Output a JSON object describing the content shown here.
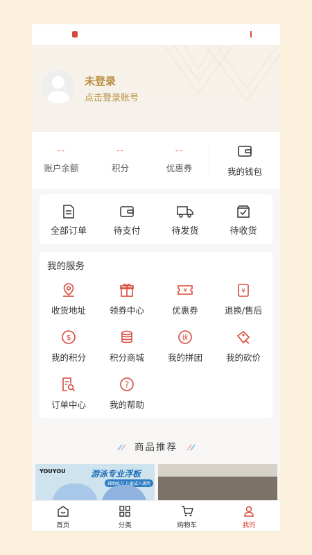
{
  "profile": {
    "name": "未登录",
    "subtitle": "点击登录账号"
  },
  "stats": [
    {
      "value": "--",
      "label": "账户余额"
    },
    {
      "value": "--",
      "label": "积分"
    },
    {
      "value": "--",
      "label": "优惠券"
    }
  ],
  "wallet": {
    "label": "我的钱包",
    "icon": "wallet-icon"
  },
  "orders": [
    {
      "label": "全部订单",
      "icon": "document-icon"
    },
    {
      "label": "待支付",
      "icon": "wallet-icon"
    },
    {
      "label": "待发货",
      "icon": "truck-icon"
    },
    {
      "label": "待收货",
      "icon": "box-check-icon"
    }
  ],
  "services": {
    "title": "我的服务",
    "items": [
      {
        "label": "收货地址",
        "icon": "location-pin-icon"
      },
      {
        "label": "领券中心",
        "icon": "gift-icon"
      },
      {
        "label": "优惠券",
        "icon": "coupon-icon"
      },
      {
        "label": "退换/售后",
        "icon": "refund-icon"
      },
      {
        "label": "我的积分",
        "icon": "dollar-circle-icon"
      },
      {
        "label": "积分商城",
        "icon": "coin-stack-icon"
      },
      {
        "label": "我的拼团",
        "icon": "group-buy-icon"
      },
      {
        "label": "我的砍价",
        "icon": "price-tag-icon"
      },
      {
        "label": "订单中心",
        "icon": "order-search-icon"
      },
      {
        "label": "我的帮助",
        "icon": "help-circle-icon"
      }
    ]
  },
  "recommend": {
    "title": "商品推荐"
  },
  "banners": [
    {
      "brand": "YOUYOU",
      "headline": "游泳专业浮板",
      "tag": "辅助练习 儿童成人通用"
    },
    {
      "brand": "",
      "headline": "",
      "tag": ""
    }
  ],
  "tabbar": [
    {
      "label": "首页",
      "icon": "home-icon",
      "active": false
    },
    {
      "label": "分类",
      "icon": "grid-icon",
      "active": false
    },
    {
      "label": "购物车",
      "icon": "cart-icon",
      "active": false
    },
    {
      "label": "我的",
      "icon": "user-icon",
      "active": true
    }
  ],
  "colors": {
    "accent": "#d8483a",
    "gold": "#b88e3e",
    "background": "#faf0dc"
  }
}
